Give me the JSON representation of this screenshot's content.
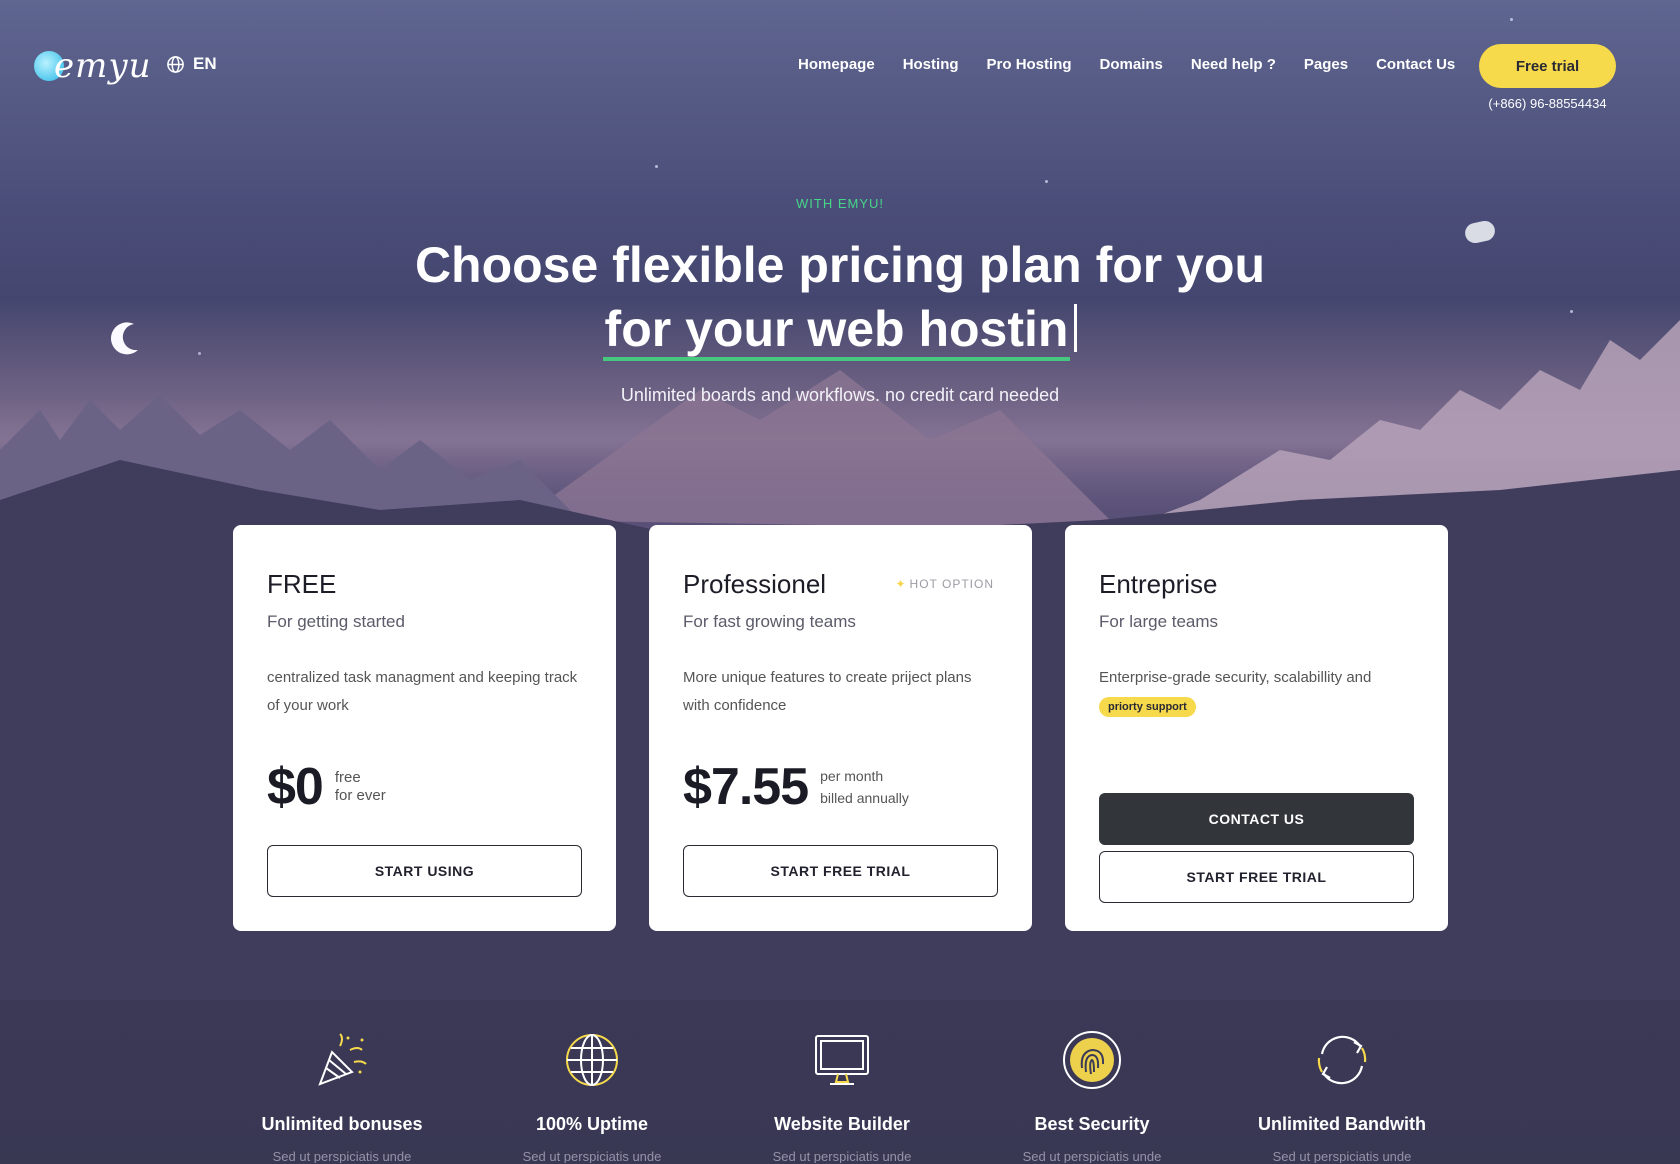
{
  "brand": {
    "logo_text": "emyu",
    "accent": "#f7d94c",
    "highlight": "#46c97e"
  },
  "header": {
    "language": "EN",
    "nav": [
      "Homepage",
      "Hosting",
      "Pro Hosting",
      "Domains",
      "Need help ?",
      "Pages",
      "Contact Us"
    ],
    "cta_label": "Free trial",
    "phone": "(+866) 96-88554434"
  },
  "hero": {
    "eyebrow": "WITH EMYU!",
    "title_line1": "Choose flexible pricing plan for you",
    "title_line2": "for your web hostin",
    "subtitle": "Unlimited boards and workflows. no credit card needed"
  },
  "plans": [
    {
      "name": "FREE",
      "tagline": "For getting started",
      "description": "centralized task managment and keeping track of your work",
      "price": "$0",
      "price_note_1": "free",
      "price_note_2": "for ever",
      "button": "START USING"
    },
    {
      "name": "Professionel",
      "tagline": "For fast growing teams",
      "badge": "HOT OPTION",
      "description": "More unique features to create priject plans with confidence",
      "price": "$7.55",
      "price_note_1": "per month",
      "price_note_2": "billed annually",
      "button": "START FREE TRIAL"
    },
    {
      "name": "Entreprise",
      "tagline": "For large teams",
      "description": "Enterprise-grade security, scalabillity and",
      "highlight": "priorty support",
      "button_primary": "CONTACT US",
      "button": "START FREE TRIAL"
    }
  ],
  "features": [
    {
      "label": "Unlimited bonuses",
      "icon": "party-popper-icon",
      "sub": "Sed ut perspiciatis unde"
    },
    {
      "label": "100% Uptime",
      "icon": "globe-icon",
      "sub": "Sed ut perspiciatis unde"
    },
    {
      "label": "Website Builder",
      "icon": "monitor-icon",
      "sub": "Sed ut perspiciatis unde"
    },
    {
      "label": "Best Security",
      "icon": "fingerprint-icon",
      "sub": "Sed ut perspiciatis unde"
    },
    {
      "label": "Unlimited Bandwith",
      "icon": "refresh-icon",
      "sub": "Sed ut perspiciatis unde"
    }
  ]
}
